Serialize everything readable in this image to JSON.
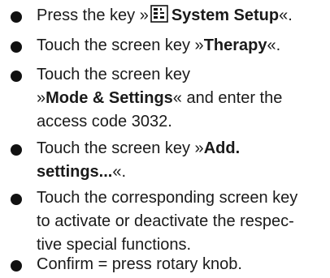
{
  "steps": [
    {
      "pre": "Press the key »",
      "key_icon": "system-setup-key-icon",
      "bold": "System Setup",
      "post": "«."
    },
    {
      "pre": "Touch the screen key »",
      "bold": "Therapy",
      "post": "«."
    },
    {
      "line1": "Touch the screen key",
      "line2_pre": "»",
      "line2_bold": "Mode & Settings",
      "line2_post": "« and enter the",
      "line3": "access code 3032."
    },
    {
      "line1_pre": "Touch the screen key »",
      "line1_bold": "Add.",
      "line2_bold": "settings...",
      "line2_post": "«."
    },
    {
      "line1": "Touch the corresponding screen key",
      "line2": "to activate or deactivate the respec-",
      "line3": "tive special functions."
    },
    {
      "text": "Confirm = press rotary knob."
    }
  ]
}
